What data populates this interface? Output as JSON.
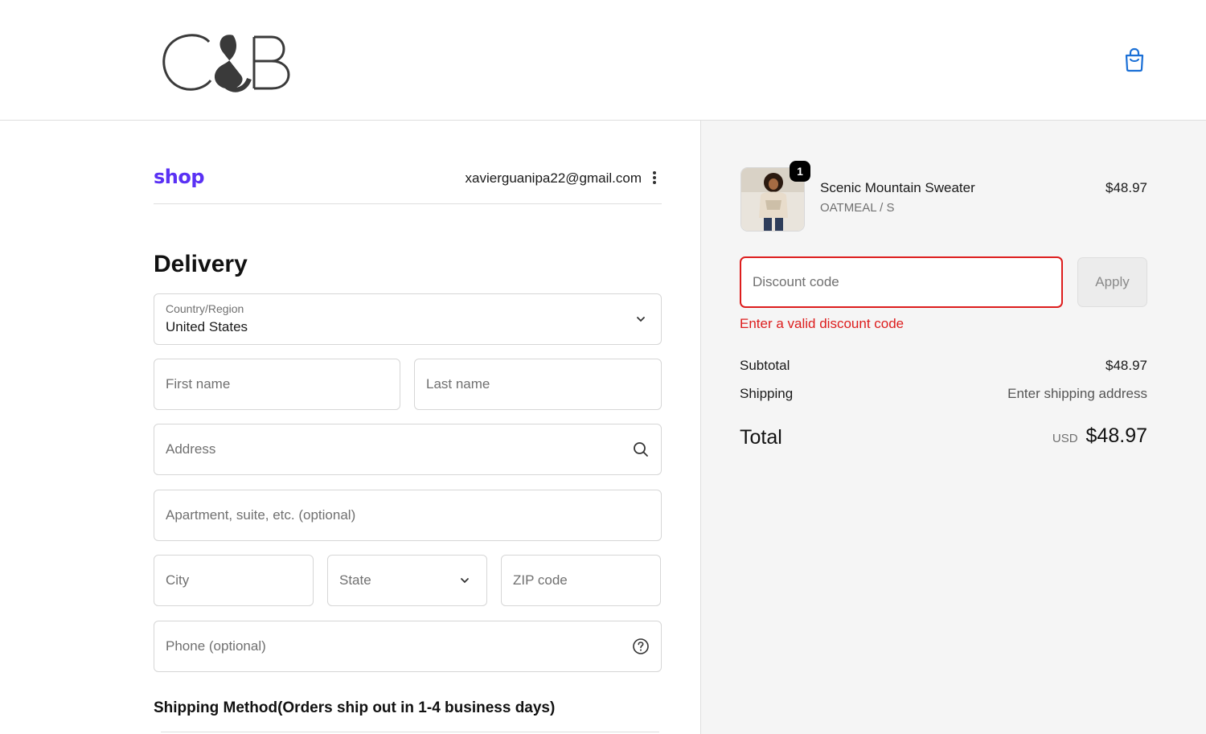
{
  "header": {
    "logo_text": "C&B",
    "cart_icon": "shopping-bag-icon"
  },
  "account": {
    "shop_label": "shop",
    "email": "xavierguanipa22@gmail.com",
    "menu_icon": "more-vertical-icon"
  },
  "delivery": {
    "title": "Delivery",
    "country": {
      "label": "Country/Region",
      "value": "United States"
    },
    "first_name": {
      "placeholder": "First name"
    },
    "last_name": {
      "placeholder": "Last name"
    },
    "address": {
      "placeholder": "Address",
      "icon": "search-icon"
    },
    "apartment": {
      "placeholder": "Apartment, suite, etc. (optional)"
    },
    "city": {
      "placeholder": "City"
    },
    "state": {
      "placeholder": "State"
    },
    "zip": {
      "placeholder": "ZIP code"
    },
    "phone": {
      "placeholder": "Phone (optional)",
      "icon": "help-circle-icon"
    },
    "shipping_method_heading": "Shipping Method(Orders ship out in 1-4 business days)"
  },
  "order_summary": {
    "item": {
      "quantity": "1",
      "name": "Scenic Mountain Sweater",
      "variant": "OATMEAL / S",
      "price": "$48.97"
    },
    "discount": {
      "placeholder": "Discount code",
      "apply_label": "Apply",
      "error": "Enter a valid discount code"
    },
    "subtotal_label": "Subtotal",
    "subtotal_value": "$48.97",
    "shipping_label": "Shipping",
    "shipping_value": "Enter shipping address",
    "total_label": "Total",
    "total_currency": "USD",
    "total_value": "$48.97"
  },
  "colors": {
    "error": "#dd1d1d",
    "shop_brand": "#5a31f4",
    "cart_icon": "#1a6fd6"
  }
}
